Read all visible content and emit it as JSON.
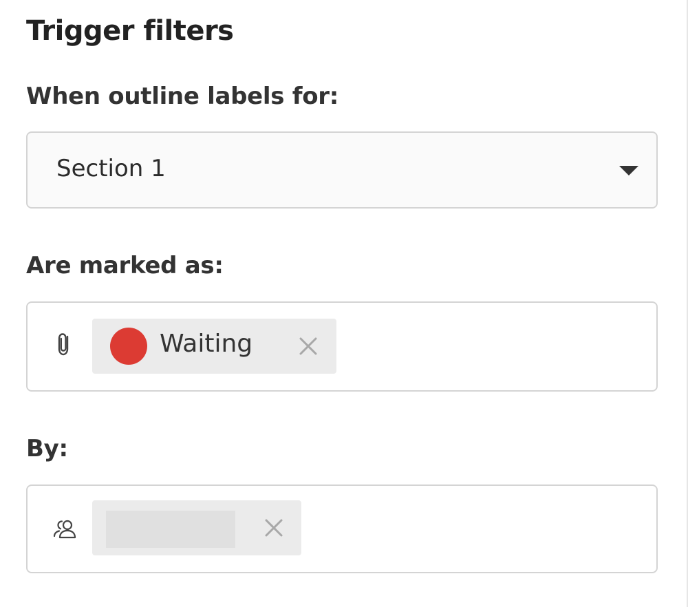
{
  "panel": {
    "title": "Trigger filters"
  },
  "outline_filter": {
    "label": "When outline labels for:",
    "selected": "Section 1",
    "arrow_icon": "caret-down-icon"
  },
  "status_filter": {
    "label": "Are marked as:",
    "field_icon": "paperclip-icon",
    "tags": [
      {
        "text": "Waiting",
        "color": "#dc3b33",
        "remove_icon": "close-icon"
      }
    ]
  },
  "user_filter": {
    "label": "By:",
    "field_icon": "users-icon",
    "tags": [
      {
        "text": "",
        "remove_icon": "close-icon"
      }
    ]
  }
}
